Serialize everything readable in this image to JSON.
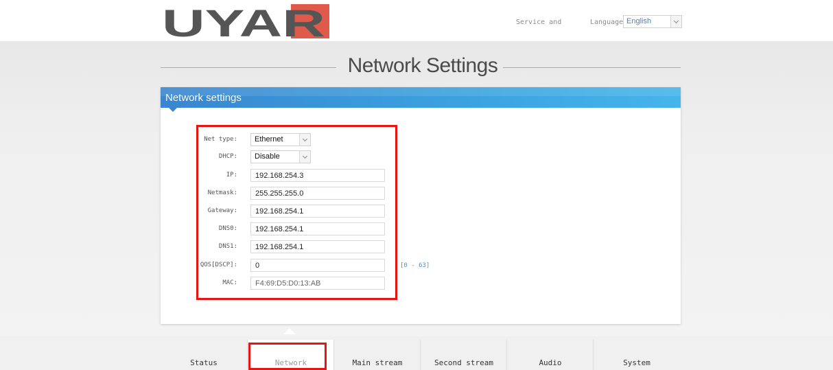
{
  "header": {
    "logo_text": "UYAR",
    "service_link": "Service and",
    "language_label": "Language:",
    "language_value": "English"
  },
  "page": {
    "title": "Network Settings"
  },
  "panel": {
    "title": "Network settings"
  },
  "form": {
    "net_type": {
      "label": "Net type:",
      "value": "Ethernet"
    },
    "dhcp": {
      "label": "DHCP:",
      "value": "Disable"
    },
    "ip": {
      "label": "IP:",
      "value": "192.168.254.3"
    },
    "netmask": {
      "label": "Netmask:",
      "value": "255.255.255.0"
    },
    "gateway": {
      "label": "Gateway:",
      "value": "192.168.254.1"
    },
    "dns0": {
      "label": "DNS0:",
      "value": "192.168.254.1"
    },
    "dns1": {
      "label": "DNS1:",
      "value": "192.168.254.1"
    },
    "qos": {
      "label": "QOS[DSCP]:",
      "value": "0",
      "range": "[0 - 63]"
    },
    "mac": {
      "label": "MAC:",
      "value": "F4:69:D5:D0:13:AB"
    }
  },
  "nav": {
    "items": [
      {
        "label": "Status"
      },
      {
        "label": "Network"
      },
      {
        "label": "Main stream"
      },
      {
        "label": "Second stream"
      },
      {
        "label": "Audio"
      },
      {
        "label": "System"
      }
    ],
    "active": "Network"
  },
  "colors": {
    "accent": "#3a86d0",
    "highlight_box": "#e8140f",
    "logo_red": "#e05a4c",
    "logo_text": "#555555"
  }
}
